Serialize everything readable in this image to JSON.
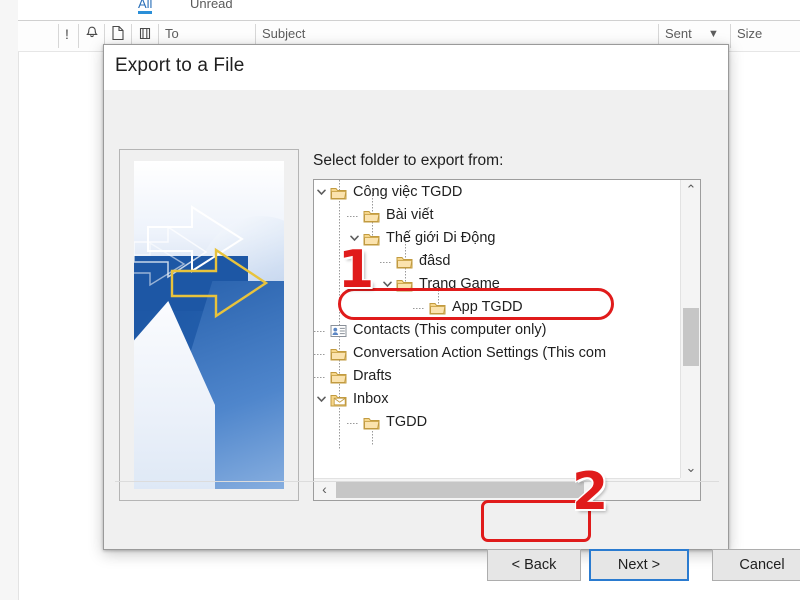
{
  "background": {
    "tabs": [
      {
        "label": "All",
        "active": true
      },
      {
        "label": "Unread",
        "active": false
      }
    ],
    "column_headers": [
      {
        "label": "!",
        "type": "icon",
        "name": "importance-icon"
      },
      {
        "label": "☉",
        "type": "icon",
        "name": "reminder-bell-icon"
      },
      {
        "label": "☐",
        "type": "icon",
        "name": "attachment-page-icon"
      },
      {
        "label": "⫼",
        "type": "icon",
        "name": "categories-icon"
      },
      {
        "label": "To",
        "type": "text"
      },
      {
        "label": "Subject",
        "type": "text"
      },
      {
        "label": "Sent",
        "type": "text",
        "sorted": true
      },
      {
        "label": "Size",
        "type": "text"
      }
    ],
    "sort_indicator": "▼"
  },
  "dialog": {
    "title": "Export to a File",
    "prompt": "Select folder to export from:",
    "artwork_name": "wizard-arrows-artwork",
    "tree": {
      "items": [
        {
          "label": "Công việc TGDD",
          "depth": 1,
          "expander": "expanded",
          "icon": "folder",
          "highlighted": false
        },
        {
          "label": "Bài viết",
          "depth": 2,
          "expander": "none",
          "icon": "folder",
          "highlighted": false
        },
        {
          "label": "Thế giới Di Động",
          "depth": 2,
          "expander": "expanded",
          "icon": "folder",
          "highlighted": false
        },
        {
          "label": "đâsd",
          "depth": 3,
          "expander": "none",
          "icon": "folder",
          "highlighted": false
        },
        {
          "label": "Trang Game",
          "depth": 3,
          "expander": "expanded",
          "icon": "folder",
          "highlighted": false
        },
        {
          "label": "App TGDD",
          "depth": 4,
          "expander": "none",
          "icon": "folder",
          "highlighted": false
        },
        {
          "label": "Contacts (This computer only)",
          "depth": 1,
          "expander": "none",
          "icon": "contacts",
          "highlighted": true
        },
        {
          "label": "Conversation Action Settings (This com",
          "depth": 1,
          "expander": "none",
          "icon": "folder",
          "highlighted": false
        },
        {
          "label": "Drafts",
          "depth": 1,
          "expander": "none",
          "icon": "folder",
          "highlighted": false
        },
        {
          "label": "Inbox",
          "depth": 1,
          "expander": "expanded",
          "icon": "inbox",
          "highlighted": false
        },
        {
          "label": "TGDD",
          "depth": 2,
          "expander": "none",
          "icon": "folder",
          "highlighted": false
        }
      ],
      "scrollbars": {
        "vertical": {
          "up": "⌃",
          "down": "⌄"
        },
        "horizontal": {
          "left": "‹",
          "right": "›"
        }
      }
    },
    "buttons": {
      "back": "< Back",
      "next": "Next >",
      "cancel": "Cancel"
    }
  },
  "annotations": [
    {
      "number": "1",
      "target": "contacts-tree-item"
    },
    {
      "number": "2",
      "target": "next-button"
    }
  ],
  "colors": {
    "annotation_red": "#e01b1b",
    "focus_blue": "#2a7bd0",
    "tab_accent": "#2a8fd8",
    "folder_yellow": "#f2c14e"
  }
}
